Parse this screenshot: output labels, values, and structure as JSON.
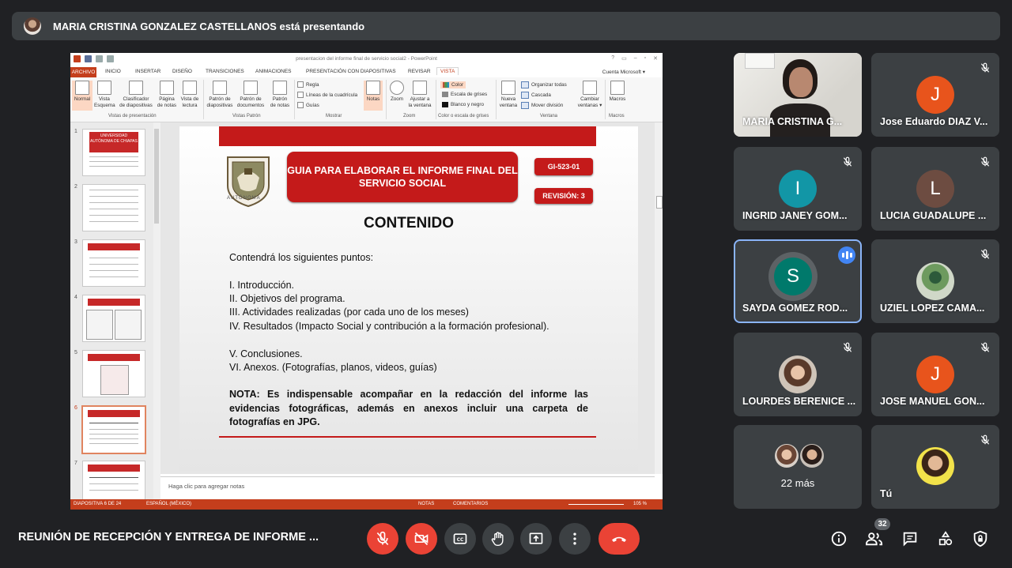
{
  "banner": {
    "text": "MARIA CRISTINA GONZALEZ CASTELLANOS está presentando"
  },
  "presentation": {
    "window_title": "presentacion del informe final de servicio social2 - PowerPoint",
    "window_controls": [
      "?",
      "▭",
      "–",
      "▫",
      "✕"
    ],
    "ribbon_tabs": [
      "ARCHIVO",
      "INICIO",
      "INSERTAR",
      "DISEÑO",
      "TRANSICIONES",
      "ANIMACIONES",
      "PRESENTACIÓN CON DIAPOSITIVAS",
      "REVISAR",
      "VISTA"
    ],
    "active_tab": "VISTA",
    "account": "Cuenta Microsoft ▾",
    "ribbon": {
      "normal": "Normal",
      "vista_esquema": [
        "Vista",
        "Esquema"
      ],
      "clasificador": [
        "Clasificador",
        "de diapositivas"
      ],
      "pagina_notas": [
        "Página",
        "de notas"
      ],
      "vista_lectura": [
        "Vista de",
        "lectura"
      ],
      "patron_diap": [
        "Patrón de",
        "diapositivas"
      ],
      "patron_doc": [
        "Patrón de",
        "documentos"
      ],
      "patron_notas": [
        "Patrón",
        "de notas"
      ],
      "regla": "Regla",
      "cuadricula": "Líneas de la cuadrícula",
      "guias": "Guías",
      "notas": "Notas",
      "zoom": "Zoom",
      "ajustar": [
        "Ajustar a",
        "la ventana"
      ],
      "color": "Color",
      "grises": "Escala de grises",
      "blanco_negro": "Blanco y negro",
      "nueva_ventana": [
        "Nueva",
        "ventana"
      ],
      "organizar": "Organizar todas",
      "cascada": "Cascada",
      "mover": "Mover división",
      "cambiar": [
        "Cambiar",
        "ventanas ▾"
      ],
      "macros": "Macros",
      "groups": [
        "Vistas de presentación",
        "Vistas Patrón",
        "Mostrar",
        "Zoom",
        "Color o escala de grises",
        "Ventana",
        "Macros"
      ]
    },
    "thumb_numbers": [
      "1",
      "2",
      "3",
      "4",
      "5",
      "6",
      "7"
    ],
    "thumb_title": "UNIVERSIDAD AUTÓNOMA DE CHIAPAS",
    "slide": {
      "emblem_label": "AUTÓNOMA",
      "guia_title": "GUIA PARA ELABORAR EL INFORME FINAL DEL SERVICIO SOCIAL",
      "code": "GI-523-01",
      "revision": "REVISIÓN: 3",
      "heading": "CONTENIDO",
      "intro": "Contendrá los siguientes puntos:",
      "items": [
        "I.  Introducción.",
        "II. Objetivos del programa.",
        "III. Actividades realizadas (por cada uno de los meses)",
        "IV. Resultados (Impacto Social y contribución a la formación profesional).",
        "V. Conclusiones.",
        "VI. Anexos. (Fotografías, planos, videos, guías)"
      ],
      "nota": "NOTA: Es indispensable acompañar en la redacción del informe las evidencias fotográficas, además en anexos incluir una carpeta de fotografías en JPG."
    },
    "notes_placeholder": "Haga clic para agregar notas",
    "status": {
      "slide": "DIAPOSITIVA 6 DE 24",
      "language": "ESPAÑOL (MÉXICO)",
      "notas": "NOTAS",
      "comentarios": "COMENTARIOS",
      "zoom": "105 %"
    }
  },
  "participants": [
    {
      "name": "MARIA CRISTINA G...",
      "type": "video"
    },
    {
      "name": "Jose Eduardo DIAZ V...",
      "initial": "J",
      "color": "#e8541c",
      "muted": true
    },
    {
      "name": "INGRID JANEY GOM...",
      "initial": "I",
      "color": "#1296a6",
      "muted": true
    },
    {
      "name": "LUCIA GUADALUPE ...",
      "initial": "L",
      "color": "#6d4c41",
      "muted": true
    },
    {
      "name": "SAYDA GOMEZ ROD...",
      "initial": "S",
      "color": "#00796b",
      "speaking": true
    },
    {
      "name": "UZIEL LOPEZ CAMA...",
      "type": "photo",
      "muted": true
    },
    {
      "name": "LOURDES BERENICE ...",
      "type": "photo",
      "muted": true
    },
    {
      "name": "JOSE MANUEL GON...",
      "initial": "J",
      "color": "#e8541c",
      "muted": true
    },
    {
      "more": "22 más"
    },
    {
      "name": "Tú",
      "type": "photo",
      "muted": true
    }
  ],
  "bottom_bar": {
    "meeting_title": "REUNIÓN DE RECEPCIÓN Y ENTREGA DE INFORME ...",
    "people_count": "32"
  },
  "colors": {
    "meet_bg": "#202124",
    "tile_bg": "#3c4043",
    "danger": "#ea4335",
    "accent_blue": "#4285f4",
    "slide_red": "#c41a1a"
  }
}
